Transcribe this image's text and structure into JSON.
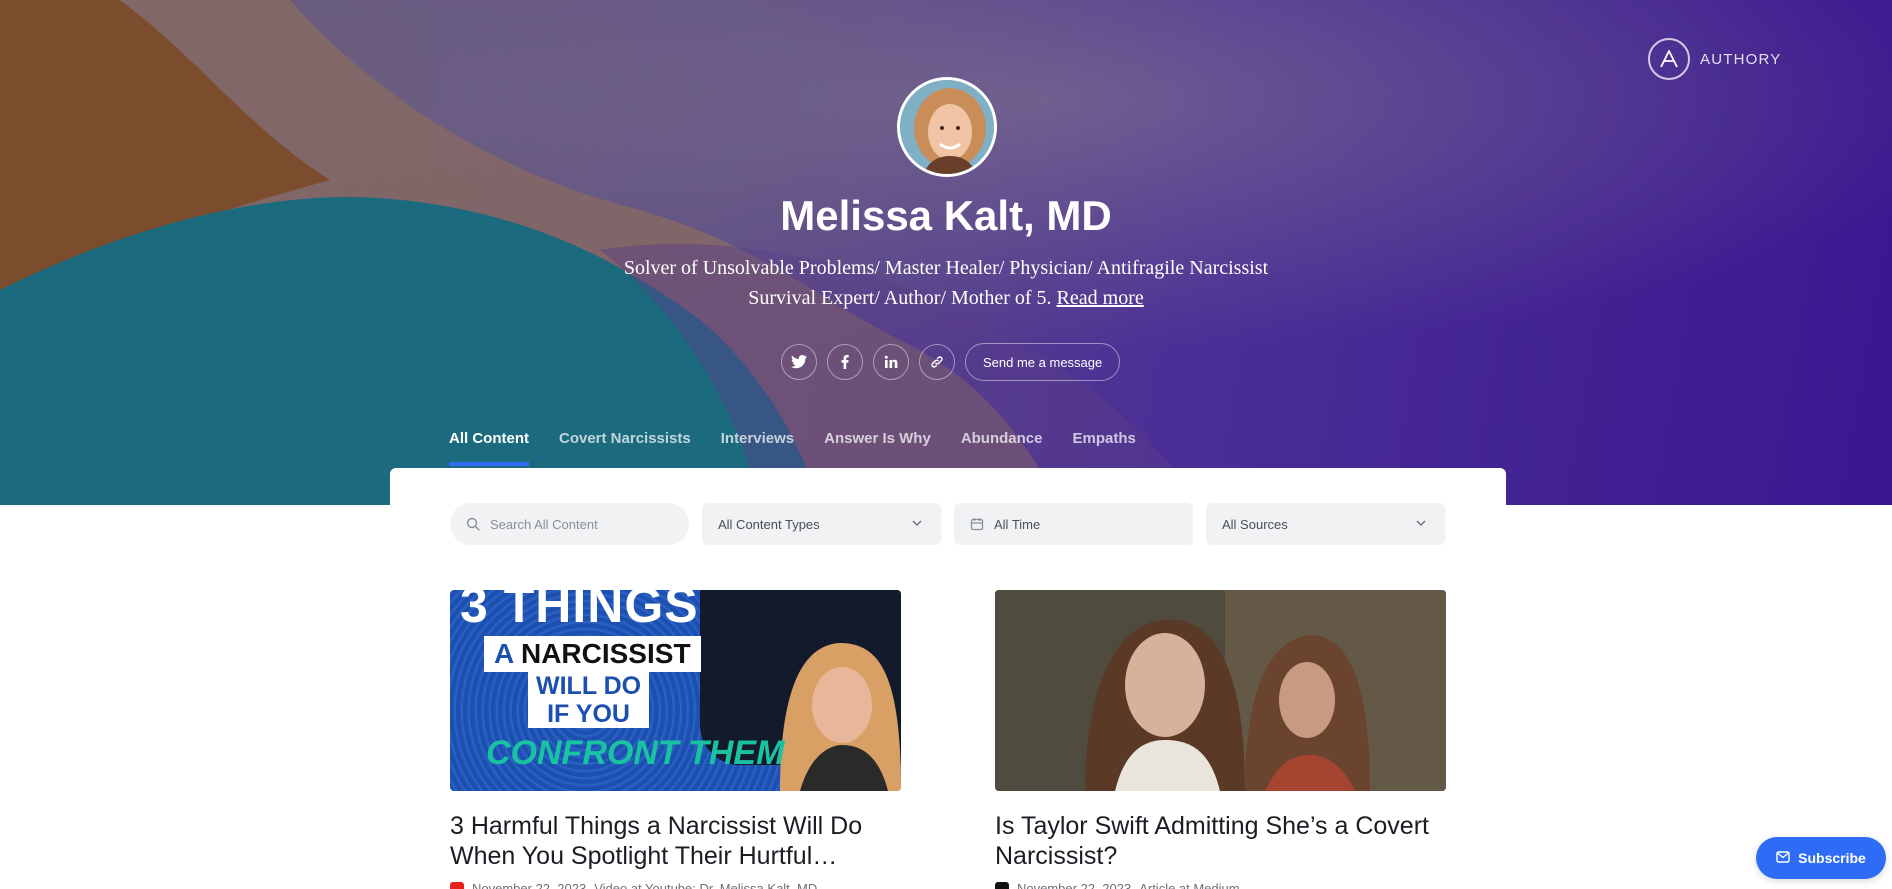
{
  "brand": {
    "name": "AUTHORY",
    "icon": "authory-logo-icon"
  },
  "profile": {
    "name": "Melissa Kalt, MD",
    "bio": "Solver of Unsolvable Problems/ Master Healer/ Physician/ Antifragile Narcissist Survival Expert/ Author/ Mother of 5.",
    "read_more": "Read more",
    "avatar_icon": "profile-photo"
  },
  "socials": [
    {
      "icon": "twitter-icon"
    },
    {
      "icon": "facebook-icon"
    },
    {
      "icon": "linkedin-icon"
    },
    {
      "icon": "link-icon"
    }
  ],
  "message_button": "Send me a message",
  "tabs": [
    {
      "label": "All Content",
      "active": true
    },
    {
      "label": "Covert Narcissists"
    },
    {
      "label": "Interviews"
    },
    {
      "label": "Answer Is Why"
    },
    {
      "label": "Abundance"
    },
    {
      "label": "Empaths"
    }
  ],
  "filters": {
    "search_placeholder": "Search All Content",
    "content_types": "All Content Types",
    "time": "All Time",
    "sources": "All Sources"
  },
  "cards": [
    {
      "title": "3 Harmful Things a Narcissist Will Do When You Spotlight Their Hurtful…",
      "date": "November 22, 2023",
      "source": "Video at Youtube: Dr. Melissa Kalt, MD",
      "thumb_text": {
        "line1": "3 THINGS",
        "line2a": "A",
        "line2b": "NARCISSIST",
        "line3": "WILL DO",
        "line4": "IF YOU",
        "line5": "CONFRONT THEM"
      },
      "source_color": "#e62117"
    },
    {
      "title": "Is Taylor Swift Admitting She’s a Covert Narcissist?",
      "date": "November 22, 2023",
      "source": "Article at Medium",
      "source_color": "#111111"
    }
  ],
  "subscribe_label": "Subscribe",
  "colors": {
    "accent": "#2f6cf6"
  }
}
